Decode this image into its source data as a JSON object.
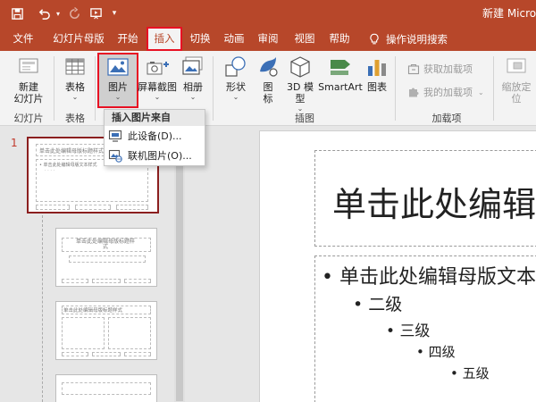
{
  "app": {
    "title": "新建 Microsoft PowerPoint 演示文稿"
  },
  "quick_access": {
    "items": [
      "save-icon",
      "undo-icon",
      "dropdown-arrow",
      "redo-icon",
      "customize-icon"
    ]
  },
  "tabs": [
    {
      "label": "文件"
    },
    {
      "label": "幻灯片母版"
    },
    {
      "label": "开始"
    },
    {
      "label": "插入"
    },
    {
      "label": "切换"
    },
    {
      "label": "动画"
    },
    {
      "label": "审阅"
    },
    {
      "label": "视图"
    },
    {
      "label": "帮助"
    }
  ],
  "tell_me": {
    "label": "操作说明搜索"
  },
  "ribbon": {
    "new_slide": "新建\n幻灯片",
    "table": "表格",
    "picture": "图片",
    "screenshot": "屏幕截图",
    "album": "相册",
    "shapes": "形状",
    "icons": "图\n标",
    "model3d": "3D 模\n型",
    "smartart": "SmartArt",
    "chart": "图表",
    "get_addins": "获取加载项",
    "my_addins": "我的加载项",
    "zoom": "缩放定\n位",
    "group_slides": "幻灯片",
    "group_table": "表格",
    "group_illustrations": "插图",
    "group_addins": "加载项"
  },
  "dropdown": {
    "header": "插入图片来自",
    "items": [
      {
        "label": "此设备(D)..."
      },
      {
        "label": "联机图片(O)..."
      }
    ]
  },
  "slide_pane": {
    "current_number": "1",
    "thumb1_title": "单击此处编辑母版标题样式",
    "thumb1_body": "• 单击此处编辑母版文本样式",
    "thumb2_title": "单击此处编辑母版标题样\n式",
    "thumb3_title": "单击此处编辑母版标题样式"
  },
  "slide": {
    "title": "单击此处编辑母版标题样式",
    "levels": [
      {
        "bullet": "•",
        "text": "单击此处编辑母版文本样式"
      },
      {
        "bullet": "•",
        "text": "二级"
      },
      {
        "bullet": "•",
        "text": "三级"
      },
      {
        "bullet": "•",
        "text": "四级"
      },
      {
        "bullet": "•",
        "text": "五级"
      }
    ]
  },
  "colors": {
    "accent": "#b7472a",
    "highlight": "#e81123"
  }
}
